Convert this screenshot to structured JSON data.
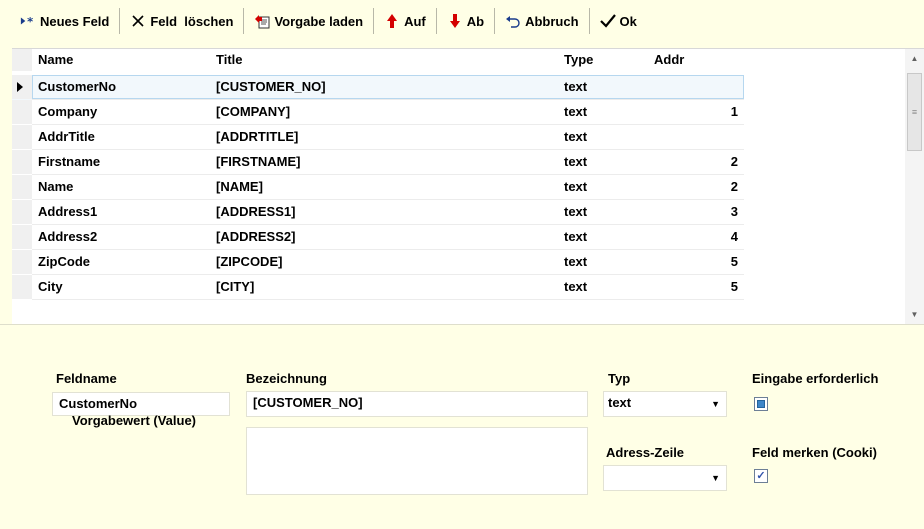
{
  "toolbar": {
    "new_field": "Neues Feld",
    "delete_field": "Feld  löschen",
    "load_default": "Vorgabe laden",
    "up": "Auf",
    "down": "Ab",
    "cancel": "Abbruch",
    "ok": "Ok"
  },
  "grid": {
    "headers": [
      "Name",
      "Title",
      "Type",
      "Addr"
    ],
    "rows": [
      {
        "name": "CustomerNo",
        "title": "[CUSTOMER_NO]",
        "type": "text",
        "addr": ""
      },
      {
        "name": "Company",
        "title": "[COMPANY]",
        "type": "text",
        "addr": "1"
      },
      {
        "name": "AddrTitle",
        "title": "[ADDRTITLE]",
        "type": "text",
        "addr": ""
      },
      {
        "name": "Firstname",
        "title": "[FIRSTNAME]",
        "type": "text",
        "addr": "2"
      },
      {
        "name": "Name",
        "title": "[NAME]",
        "type": "text",
        "addr": "2"
      },
      {
        "name": "Address1",
        "title": "[ADDRESS1]",
        "type": "text",
        "addr": "3"
      },
      {
        "name": "Address2",
        "title": "[ADDRESS2]",
        "type": "text",
        "addr": "4"
      },
      {
        "name": "ZipCode",
        "title": "[ZIPCODE]",
        "type": "text",
        "addr": "5"
      },
      {
        "name": "City",
        "title": "[CITY]",
        "type": "text",
        "addr": "5"
      }
    ],
    "selected_row": 0
  },
  "form": {
    "fieldname_label": "Feldname",
    "fieldname_value": "CustomerNo",
    "bezeichnung_label": "Bezeichnung",
    "bezeichnung_value": "[CUSTOMER_NO]",
    "typ_label": "Typ",
    "typ_value": "text",
    "required_label": "Eingabe erforderlich",
    "required_checked": true,
    "default_label": "Vorgabewert (Value)",
    "default_value": "",
    "address_line_label": "Adress-Zeile",
    "address_line_value": "",
    "remember_label": "Feld merken (Cooki)",
    "remember_checked": true
  },
  "colors": {
    "background": "#ffffe6",
    "selection": "#f2f8fc",
    "up_arrow": "#d40000",
    "down_arrow": "#d40000"
  }
}
